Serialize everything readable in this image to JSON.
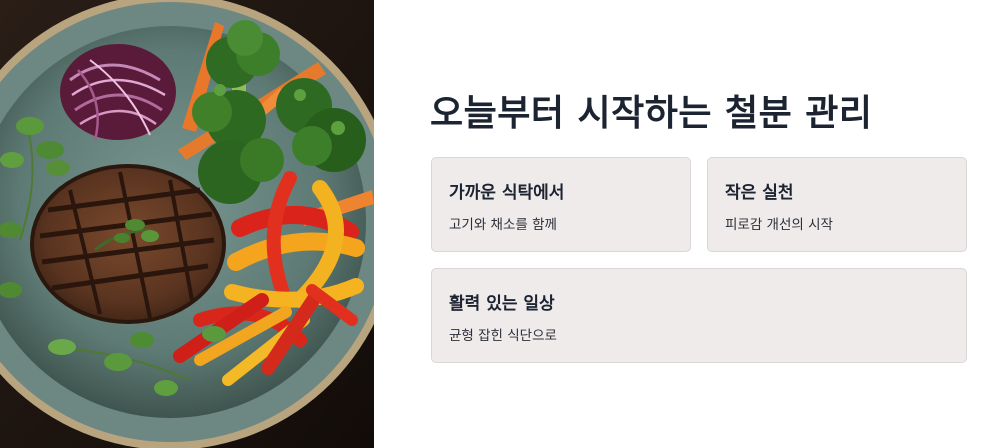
{
  "photo": {
    "icon": "steak-vegetable-plate-image"
  },
  "heading": "오늘부터 시작하는 철분 관리",
  "cards": [
    {
      "title": "가까운 식탁에서",
      "description": "고기와 채소를 함께"
    },
    {
      "title": "작은 실천",
      "description": "피로감 개선의 시작"
    },
    {
      "title": "활력 있는 일상",
      "description": "균형 잡힌 식단으로"
    }
  ],
  "colors": {
    "heading": "#1c2331",
    "card_background": "#f0ebeb",
    "card_border": "#ddd6d6",
    "plate": "#5f7c77"
  }
}
